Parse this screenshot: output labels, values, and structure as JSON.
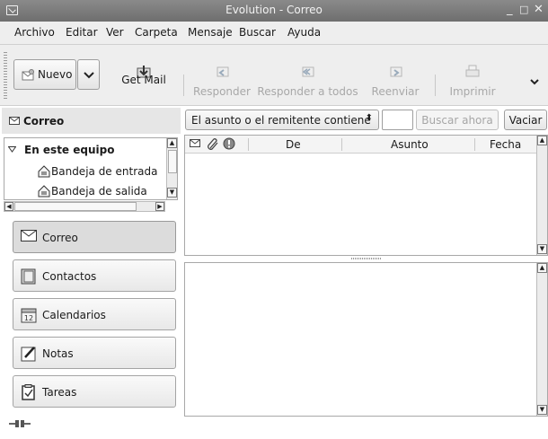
{
  "window": {
    "title": "Evolution - Correo"
  },
  "menu": [
    "Archivo",
    "Editar",
    "Ver",
    "Carpeta",
    "Mensaje",
    "Buscar",
    "Ayuda"
  ],
  "toolbar": {
    "new_label": "Nuevo",
    "get_mail_label": "Get Mail",
    "reply_label": "Responder",
    "reply_all_label": "Responder a todos",
    "forward_label": "Reenviar",
    "print_label": "Imprimir"
  },
  "sidebar": {
    "header": "Correo",
    "tree": {
      "group": "En este equipo",
      "items": [
        "Bandeja de entrada",
        "Bandeja de salida"
      ]
    },
    "nav": [
      "Correo",
      "Contactos",
      "Calendarios",
      "Notas",
      "Tareas"
    ],
    "calendar_icon_day": "12"
  },
  "search": {
    "filter_label": "El asunto o el remitente contiene",
    "query": "",
    "find_label": "Buscar ahora",
    "clear_label": "Vaciar"
  },
  "message_list": {
    "columns": [
      "De",
      "Asunto",
      "Fecha"
    ]
  },
  "colors": {
    "titlebar": "#7a7a7a",
    "panel": "#eeeeee",
    "disabled_text": "#a8a8a8"
  }
}
